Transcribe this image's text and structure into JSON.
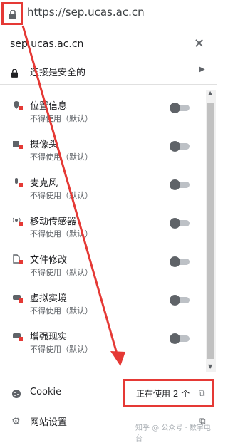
{
  "address_bar": {
    "url": "https://sep.ucas.ac.cn"
  },
  "popup": {
    "site": "sep.ucas.ac.cn",
    "secure_label": "连接是安全的",
    "permissions": [
      {
        "name": "位置信息",
        "status": "不得使用（默认）",
        "icon": "location-icon"
      },
      {
        "name": "摄像头",
        "status": "不得使用（默认）",
        "icon": "camera-icon"
      },
      {
        "name": "麦克风",
        "status": "不得使用（默认）",
        "icon": "microphone-icon"
      },
      {
        "name": "移动传感器",
        "status": "不得使用（默认）",
        "icon": "sensor-icon"
      },
      {
        "name": "文件修改",
        "status": "不得使用（默认）",
        "icon": "file-edit-icon"
      },
      {
        "name": "虚拟实境",
        "status": "不得使用（默认）",
        "icon": "vr-icon"
      },
      {
        "name": "增强现实",
        "status": "不得使用（默认）",
        "icon": "ar-icon"
      }
    ],
    "cookie": {
      "label": "Cookie",
      "count": "正在使用 2 个"
    },
    "site_settings": "网站设置"
  },
  "watermark": "知乎 @ 公众号 · 数字电台",
  "colors": {
    "highlight": "#e53935",
    "toggle_off": "#5f6368"
  }
}
